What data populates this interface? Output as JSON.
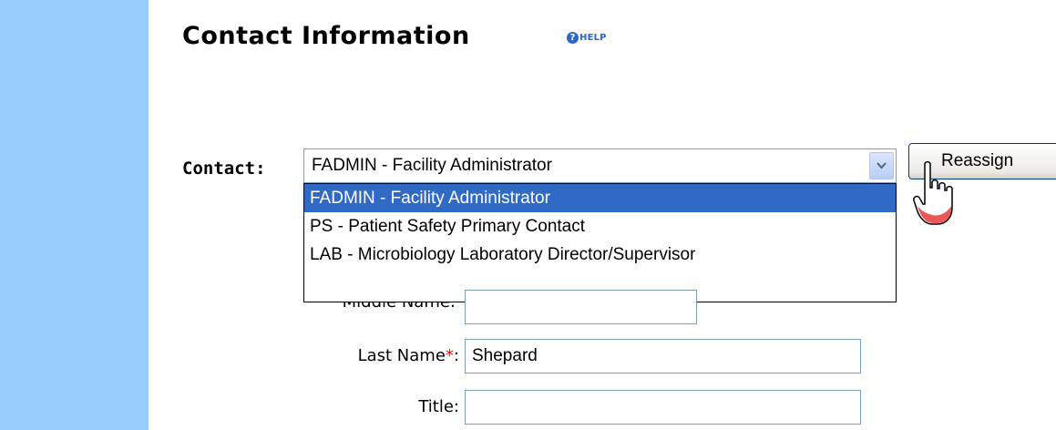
{
  "page": {
    "title": "Contact Information",
    "help_label": "HELP",
    "help_icon": "question-circle-icon"
  },
  "contact": {
    "label": "Contact:",
    "selected": "FADMIN - Facility Administrator",
    "options": [
      "FADMIN - Facility Administrator",
      "PS - Patient Safety Primary Contact",
      "LAB - Microbiology Laboratory Director/Supervisor"
    ],
    "reassign_label": "Reassign"
  },
  "fields": {
    "middle_name": {
      "label": "Middle Name:",
      "value": ""
    },
    "last_name": {
      "label": "Last Name",
      "required_mark": "*",
      "suffix": ":",
      "value": "Shepard"
    },
    "title": {
      "label": "Title:",
      "value": ""
    }
  },
  "colors": {
    "sidebar": "#99ccff",
    "selection": "#316ac5",
    "help": "#2a67c8",
    "required": "#ff0000"
  }
}
